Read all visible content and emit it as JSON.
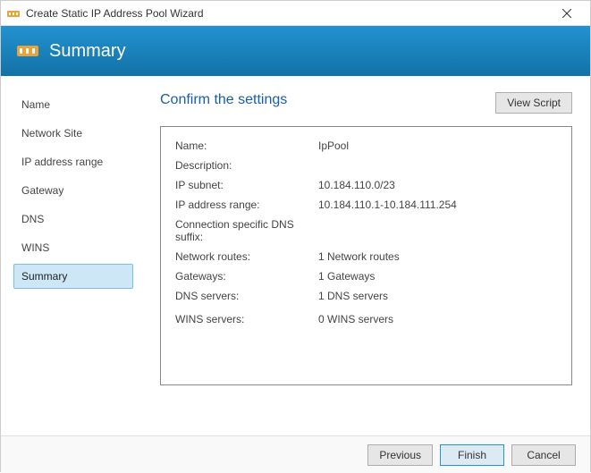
{
  "window": {
    "title": "Create Static IP Address Pool Wizard"
  },
  "banner": {
    "title": "Summary"
  },
  "sidebar": {
    "items": [
      {
        "label": "Name"
      },
      {
        "label": "Network Site"
      },
      {
        "label": "IP address range"
      },
      {
        "label": "Gateway"
      },
      {
        "label": "DNS"
      },
      {
        "label": "WINS"
      },
      {
        "label": "Summary"
      }
    ],
    "selected_index": 6
  },
  "main": {
    "title": "Confirm the settings",
    "view_script": "View Script",
    "settings": {
      "name_label": "Name:",
      "name_value": "IpPool",
      "description_label": "Description:",
      "description_value": "",
      "subnet_label": "IP subnet:",
      "subnet_value": "10.184.110.0/23",
      "range_label": "IP address range:",
      "range_value": "10.184.110.1-10.184.111.254",
      "dns_suffix_label": "Connection specific DNS suffix:",
      "dns_suffix_value": "",
      "routes_label": "Network routes:",
      "routes_value": "1 Network routes",
      "gateways_label": "Gateways:",
      "gateways_value": "1 Gateways",
      "dns_servers_label": "DNS servers:",
      "dns_servers_value": "1 DNS servers",
      "wins_servers_label": "WINS servers:",
      "wins_servers_value": "0 WINS servers"
    }
  },
  "footer": {
    "previous": "Previous",
    "finish": "Finish",
    "cancel": "Cancel"
  }
}
